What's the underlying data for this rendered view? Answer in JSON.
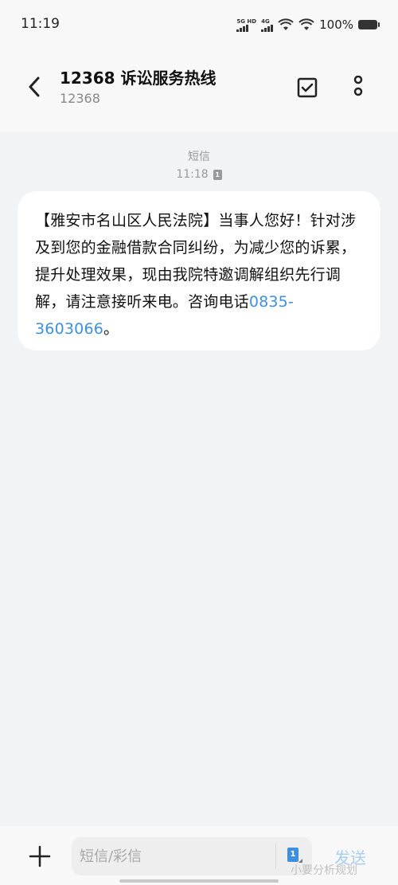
{
  "status_bar": {
    "time": "11:19",
    "network_1": "5G HD",
    "network_2": "4G",
    "battery": "100%"
  },
  "header": {
    "title": "12368 诉讼服务热线",
    "subtitle": "12368",
    "back_icon": "chevron-left-icon",
    "select_icon": "checkbox-icon",
    "more_icon": "more-vertical-icon"
  },
  "messages": {
    "type_label": "短信",
    "time": "11:18",
    "sim": "1",
    "body_text": "【雅安市名山区人民法院】当事人您好！针对涉及到您的金融借款合同纠纷，为减少您的诉累，提升处理效果，现由我院特邀调解组织先行调解，请注意接听来电。咨询电话",
    "phone": "0835-3603066",
    "body_end": "。"
  },
  "input_bar": {
    "placeholder": "短信/彩信",
    "sim": "1",
    "send_label": "发送",
    "add_icon": "plus-icon"
  },
  "watermark": "小要分析规划",
  "colors": {
    "link": "#3d8fe0",
    "send_disabled": "#a9cdf0",
    "background": "#f2f3f4"
  }
}
